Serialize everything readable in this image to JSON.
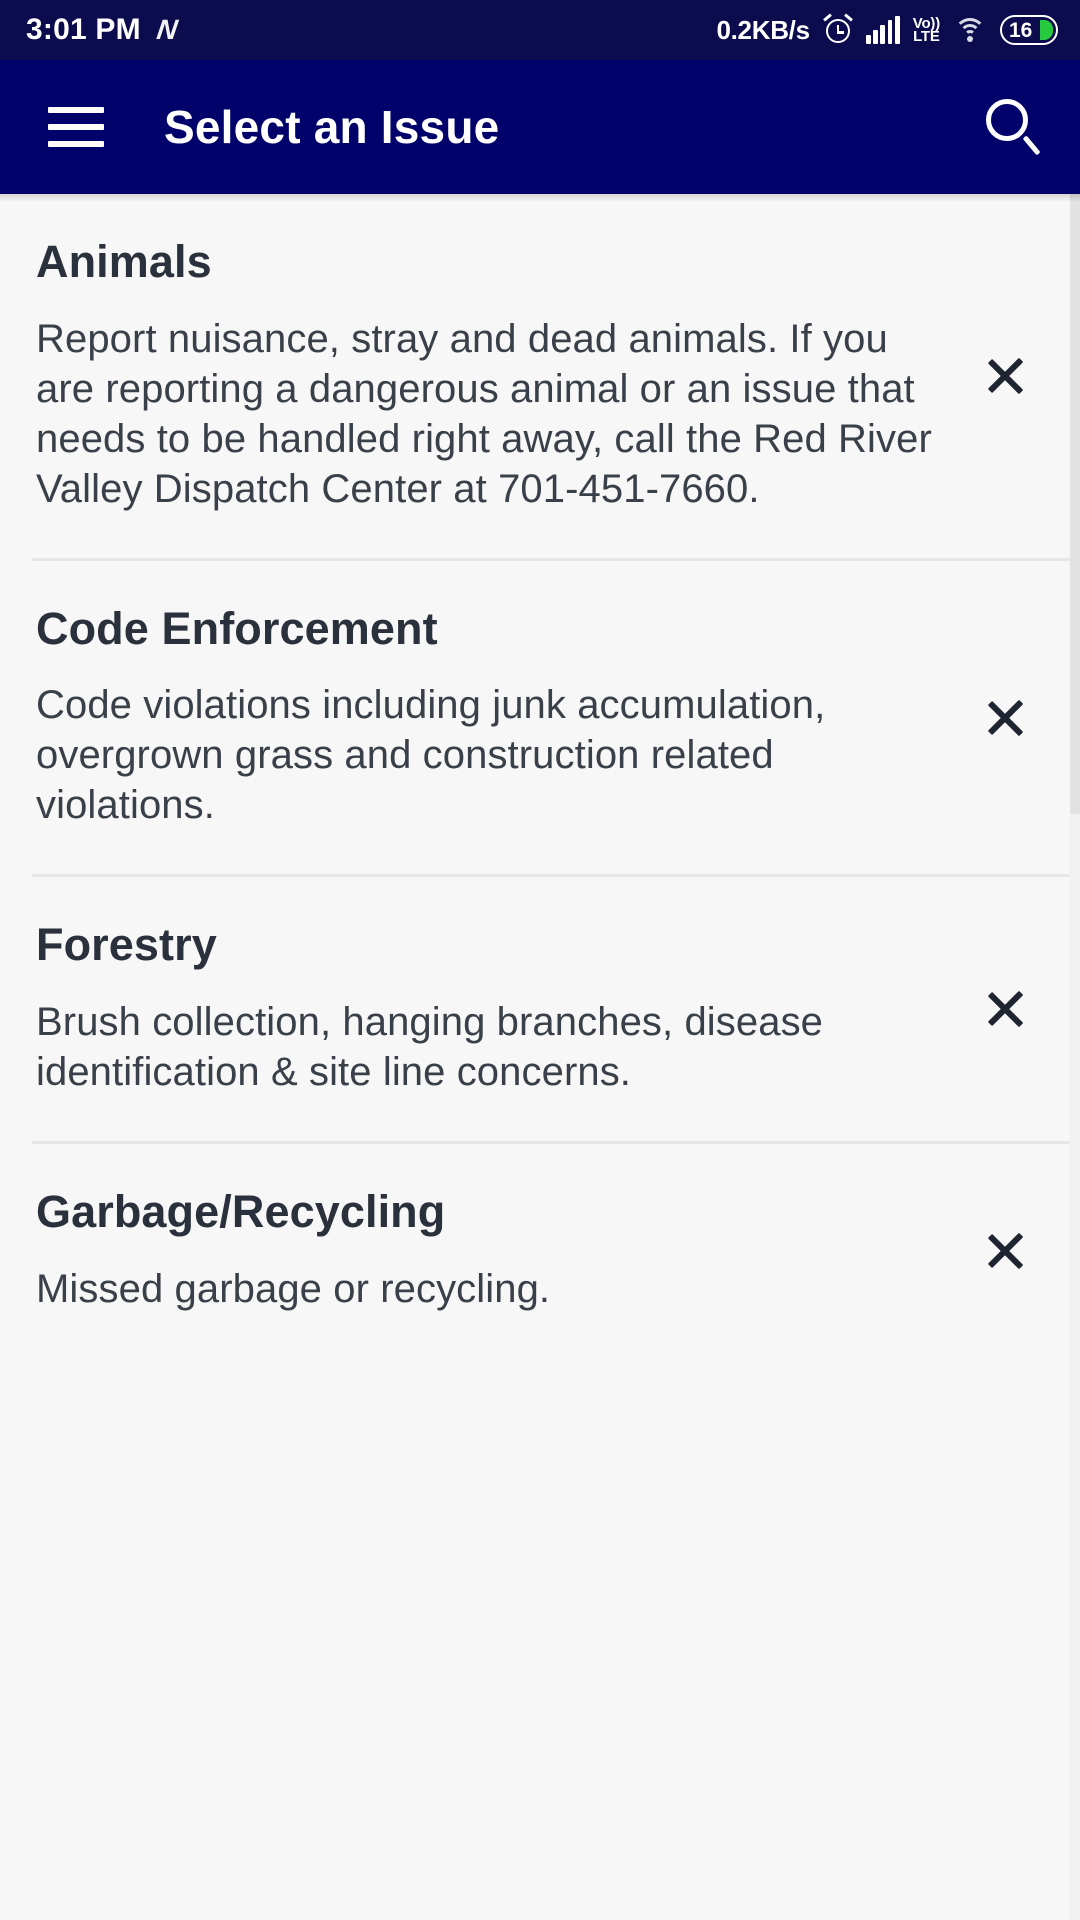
{
  "status_bar": {
    "time": "3:01 PM",
    "carrier_logo": "N",
    "network_speed": "0.2KB/s",
    "alarm_icon": "alarm-icon",
    "signal_icon": "cellular-signal-icon",
    "volte_label_top": "Vo))",
    "volte_label_bottom": "LTE",
    "wifi_icon": "wifi-icon",
    "battery_level": "16",
    "bg_color": "#0b0b4d"
  },
  "app_bar": {
    "menu_icon": "hamburger-menu-icon",
    "title": "Select an Issue",
    "search_icon": "search-icon",
    "bg_color": "#02026b",
    "text_color": "#ffffff"
  },
  "list": {
    "items": [
      {
        "title": "Animals",
        "description": "Report nuisance, stray and dead animals. If you are reporting a dangerous animal or an issue that needs to be handled right away, call the Red River Valley Dispatch Center at 701-451-7660.",
        "chevron": "chevron-right-icon"
      },
      {
        "title": "Code Enforcement",
        "description": "Code violations including junk accumulation, overgrown grass and construction related violations.",
        "chevron": "chevron-right-icon"
      },
      {
        "title": "Forestry",
        "description": "Brush collection, hanging branches, disease identification & site line concerns.",
        "chevron": "chevron-right-icon"
      },
      {
        "title": "Garbage/Recycling",
        "description": "Missed garbage or recycling.",
        "chevron": "chevron-right-icon"
      }
    ]
  },
  "theme": {
    "page_background": "#f7f7f7",
    "title_color": "#2b313c",
    "body_color": "#3a4049",
    "divider_color": "#e6e6e6",
    "accent_navy": "#02026b"
  }
}
